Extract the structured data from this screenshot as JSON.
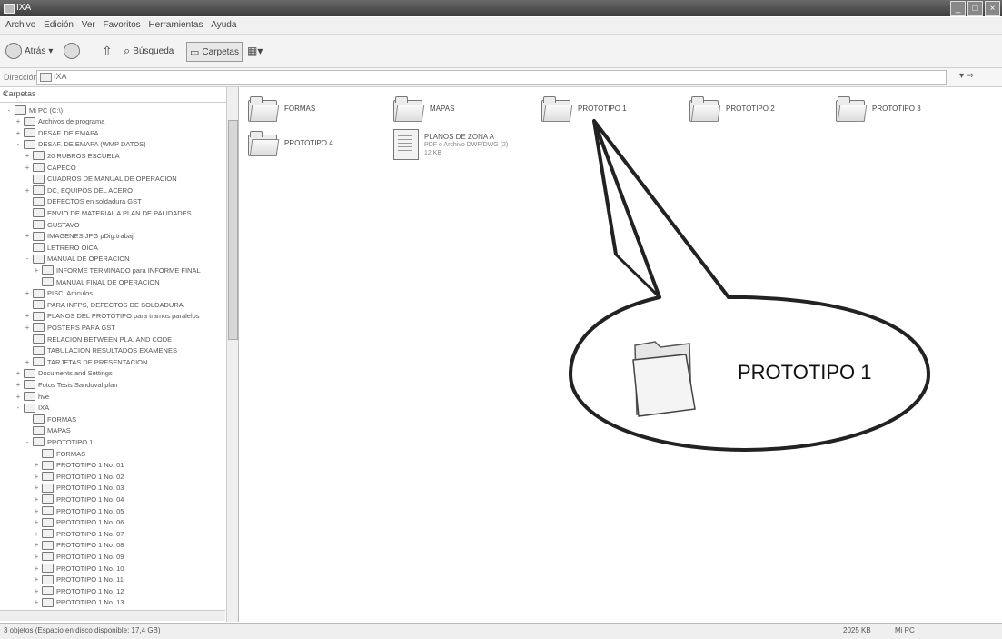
{
  "window": {
    "title": "IXA",
    "buttons": [
      "_",
      "□",
      "×"
    ]
  },
  "menu": [
    "Archivo",
    "Edición",
    "Ver",
    "Favoritos",
    "Herramientas",
    "Ayuda"
  ],
  "toolbar": {
    "back_label": "Atrás",
    "search_label": "Búsqueda",
    "folders_label": "Carpetas"
  },
  "address": {
    "label": "Dirección",
    "value": "IXA"
  },
  "sidebar": {
    "title": "Carpetas",
    "close": "×",
    "tree": [
      {
        "indent": 0,
        "exp": "-",
        "label": "Mi PC (C:\\)"
      },
      {
        "indent": 1,
        "exp": "+",
        "label": "Archivos de programa"
      },
      {
        "indent": 1,
        "exp": "+",
        "label": "DESAF. DE EMAPA"
      },
      {
        "indent": 1,
        "exp": "-",
        "label": "DESAF. DE EMAPA (WMP DATOS)"
      },
      {
        "indent": 2,
        "exp": "+",
        "label": "20 RUBROS ESCUELA"
      },
      {
        "indent": 2,
        "exp": "+",
        "label": "CAPECO"
      },
      {
        "indent": 2,
        "exp": "",
        "label": "CUADROS DE MANUAL DE OPERACION"
      },
      {
        "indent": 2,
        "exp": "+",
        "label": "DC, EQUIPOS DEL ACERO"
      },
      {
        "indent": 2,
        "exp": "",
        "label": "DEFECTOS en soldadura GST"
      },
      {
        "indent": 2,
        "exp": "",
        "label": "ENVIO DE MATERIAL A PLAN DE PALIDADES"
      },
      {
        "indent": 2,
        "exp": "",
        "label": "GUSTAVO"
      },
      {
        "indent": 2,
        "exp": "+",
        "label": "IMAGENES JPG pDig.trabaj"
      },
      {
        "indent": 2,
        "exp": "",
        "label": "LETRERO OICA"
      },
      {
        "indent": 2,
        "exp": "-",
        "label": "MANUAL DE OPERACION"
      },
      {
        "indent": 3,
        "exp": "+",
        "label": "INFORME TERMINADO para INFORME FINAL"
      },
      {
        "indent": 3,
        "exp": "",
        "label": "MANUAL FINAL DE OPERACION"
      },
      {
        "indent": 2,
        "exp": "+",
        "label": "PISCI Articulos"
      },
      {
        "indent": 2,
        "exp": "",
        "label": "PARA INFPS, DEFECTOS DE SOLDADURA"
      },
      {
        "indent": 2,
        "exp": "+",
        "label": "PLANOS DEL PROTOTIPO para tramos paralelos"
      },
      {
        "indent": 2,
        "exp": "+",
        "label": "POSTERS PARA GST"
      },
      {
        "indent": 2,
        "exp": "",
        "label": "RELACION BETWEEN PLA. AND CODE"
      },
      {
        "indent": 2,
        "exp": "",
        "label": "TABULACION RESULTADOS EXAMENES"
      },
      {
        "indent": 2,
        "exp": "+",
        "label": "TARJETAS DE PRESENTACION"
      },
      {
        "indent": 1,
        "exp": "+",
        "label": "Documents and Settings"
      },
      {
        "indent": 1,
        "exp": "+",
        "label": "Fotos Tesis Sandoval plan"
      },
      {
        "indent": 1,
        "exp": "+",
        "label": "hve"
      },
      {
        "indent": 1,
        "exp": "-",
        "label": "IXA"
      },
      {
        "indent": 2,
        "exp": "",
        "label": "FORMAS"
      },
      {
        "indent": 2,
        "exp": "",
        "label": "MAPAS"
      },
      {
        "indent": 2,
        "exp": "-",
        "label": "PROTOTIPO 1"
      },
      {
        "indent": 3,
        "exp": "",
        "label": "FORMAS"
      },
      {
        "indent": 3,
        "exp": "+",
        "label": "PROTOTIPO 1 No. 01"
      },
      {
        "indent": 3,
        "exp": "+",
        "label": "PROTOTIPO 1 No. 02"
      },
      {
        "indent": 3,
        "exp": "+",
        "label": "PROTOTIPO 1 No. 03"
      },
      {
        "indent": 3,
        "exp": "+",
        "label": "PROTOTIPO 1 No. 04"
      },
      {
        "indent": 3,
        "exp": "+",
        "label": "PROTOTIPO 1 No. 05"
      },
      {
        "indent": 3,
        "exp": "+",
        "label": "PROTOTIPO 1 No. 06"
      },
      {
        "indent": 3,
        "exp": "+",
        "label": "PROTOTIPO 1 No. 07"
      },
      {
        "indent": 3,
        "exp": "+",
        "label": "PROTOTIPO 1 No. 08"
      },
      {
        "indent": 3,
        "exp": "+",
        "label": "PROTOTIPO 1 No. 09"
      },
      {
        "indent": 3,
        "exp": "+",
        "label": "PROTOTIPO 1 No. 10"
      },
      {
        "indent": 3,
        "exp": "+",
        "label": "PROTOTIPO 1 No. 11"
      },
      {
        "indent": 3,
        "exp": "+",
        "label": "PROTOTIPO 1 No. 12"
      },
      {
        "indent": 3,
        "exp": "+",
        "label": "PROTOTIPO 1 No. 13"
      }
    ]
  },
  "content": {
    "folders": [
      "FORMAS",
      "MAPAS",
      "PROTOTIPO 1",
      "PROTOTIPO 2",
      "PROTOTIPO 3",
      "PROTOTIPO 4"
    ],
    "document": {
      "name": "PLANOS DE ZONA A",
      "line1": "PDF o Archivo DWF/DWG (2)",
      "line2": "12 KB"
    }
  },
  "callout": {
    "label": "PROTOTIPO 1"
  },
  "status": {
    "left": "3 objetos (Espacio en disco disponible: 17,4 GB)",
    "size": "2025 KB",
    "zone": "Mi PC"
  },
  "colors": {
    "titlebar": "#4a4a4a",
    "panel_bg": "#f0f0f0"
  }
}
